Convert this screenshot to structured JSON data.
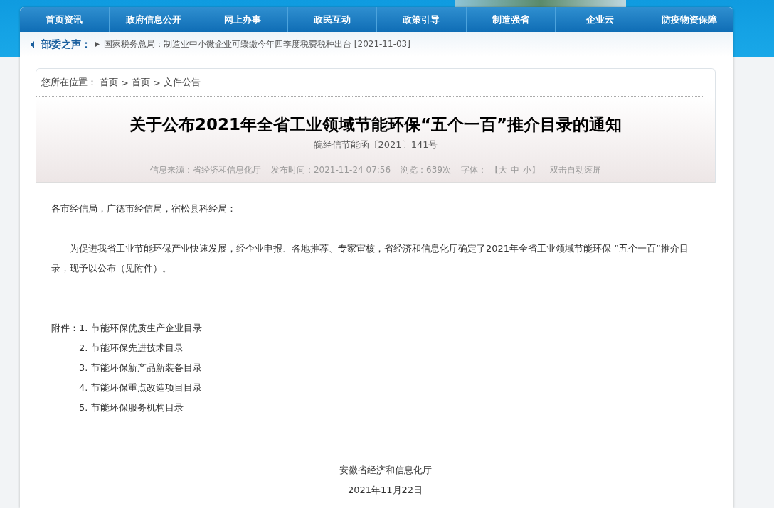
{
  "nav": [
    {
      "label": "首页资讯"
    },
    {
      "label": "政府信息公开"
    },
    {
      "label": "网上办事"
    },
    {
      "label": "政民互动"
    },
    {
      "label": "政策引导"
    },
    {
      "label": "制造强省"
    },
    {
      "label": "企业云"
    },
    {
      "label": "防疫物资保障"
    }
  ],
  "ticker": {
    "label": "部委之声：",
    "text": "国家税务总局：制造业中小微企业可缓缴今年四季度税费税种出台 [2021-11-03]"
  },
  "breadcrumb": [
    "您所在位置：",
    "首页",
    ">",
    "首页",
    ">",
    "文件公告"
  ],
  "article": {
    "title": "关于公布2021年全省工业领域节能环保“五个一百”推介目录的通知",
    "doc_number": "皖经信节能函〔2021〕141号",
    "meta": [
      "信息来源：省经济和信息化厅",
      "发布时间：2021-11-24 07:56",
      "浏览：639次"
    ],
    "font_label": "字体：",
    "font_sizes": [
      "【大",
      "中",
      "小】"
    ],
    "autoscroll": "双击自动滚屏",
    "salutation": "各市经信局，广德市经信局，宿松县科经局：",
    "body": "为促进我省工业节能环保产业快速发展，经企业申报、各地推荐、专家审核，省经济和信息化厅确定了2021年全省工业领域节能环保 “五个一百”推介目录，现予以公布（见附件）。",
    "attachments_label": "附件：",
    "attachments": [
      "1. 节能环保优质生产企业目录",
      "2. 节能环保先进技术目录",
      "3. 节能环保新产品新装备目录",
      "4. 节能环保重点改造项目目录",
      "5. 节能环保服务机构目录"
    ],
    "signature": "安徽省经济和信息化厅",
    "date": "2021年11月22日"
  }
}
